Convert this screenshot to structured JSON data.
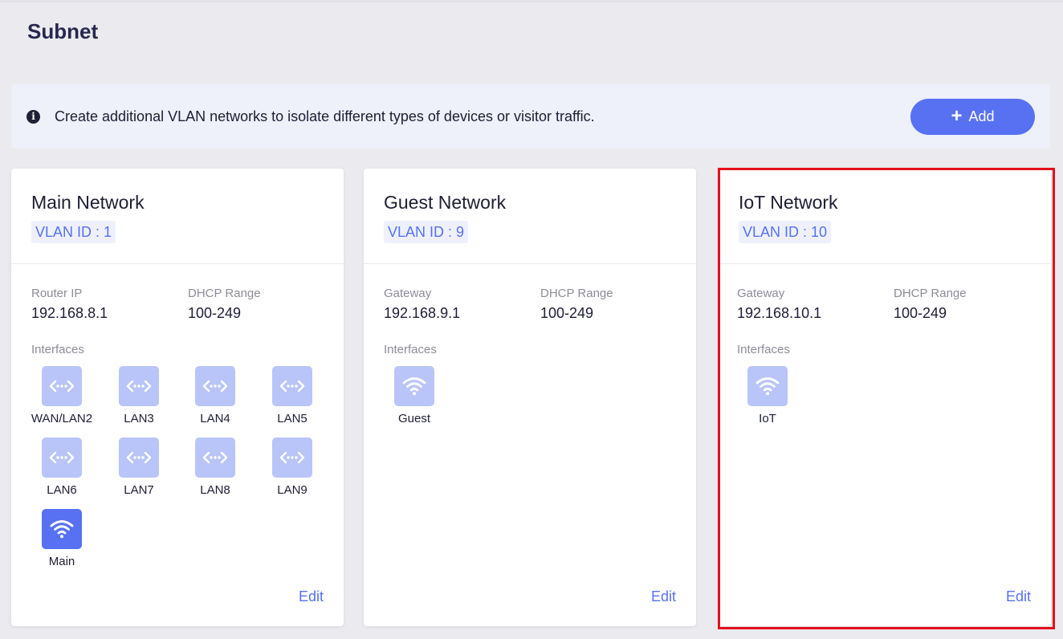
{
  "page": {
    "title": "Subnet"
  },
  "banner": {
    "icon": "info-icon",
    "text": "Create additional VLAN networks to isolate different types of devices or visitor traffic.",
    "add_label": "Add"
  },
  "colors": {
    "accent": "#5771f2",
    "tile_inactive": "#b9c5f9",
    "highlight": "#e4101a"
  },
  "cards": [
    {
      "title": "Main Network",
      "vlan": "VLAN ID : 1",
      "ip_label": "Router IP",
      "ip_value": "192.168.8.1",
      "dhcp_label": "DHCP Range",
      "dhcp_value": "100-249",
      "interfaces_label": "Interfaces",
      "interfaces": [
        {
          "label": "WAN/LAN2",
          "icon": "ethernet-icon",
          "active": false
        },
        {
          "label": "LAN3",
          "icon": "ethernet-icon",
          "active": false
        },
        {
          "label": "LAN4",
          "icon": "ethernet-icon",
          "active": false
        },
        {
          "label": "LAN5",
          "icon": "ethernet-icon",
          "active": false
        },
        {
          "label": "LAN6",
          "icon": "ethernet-icon",
          "active": false
        },
        {
          "label": "LAN7",
          "icon": "ethernet-icon",
          "active": false
        },
        {
          "label": "LAN8",
          "icon": "ethernet-icon",
          "active": false
        },
        {
          "label": "LAN9",
          "icon": "ethernet-icon",
          "active": false
        },
        {
          "label": "Main",
          "icon": "wifi-icon",
          "active": true
        }
      ],
      "edit_label": "Edit"
    },
    {
      "title": "Guest Network",
      "vlan": "VLAN ID : 9",
      "ip_label": "Gateway",
      "ip_value": "192.168.9.1",
      "dhcp_label": "DHCP Range",
      "dhcp_value": "100-249",
      "interfaces_label": "Interfaces",
      "interfaces": [
        {
          "label": "Guest",
          "icon": "wifi-icon",
          "active": false
        }
      ],
      "edit_label": "Edit"
    },
    {
      "title": "IoT Network",
      "vlan": "VLAN ID : 10",
      "ip_label": "Gateway",
      "ip_value": "192.168.10.1",
      "dhcp_label": "DHCP Range",
      "dhcp_value": "100-249",
      "interfaces_label": "Interfaces",
      "interfaces": [
        {
          "label": "IoT",
          "icon": "wifi-icon",
          "active": false
        }
      ],
      "edit_label": "Edit",
      "highlighted": true
    }
  ]
}
